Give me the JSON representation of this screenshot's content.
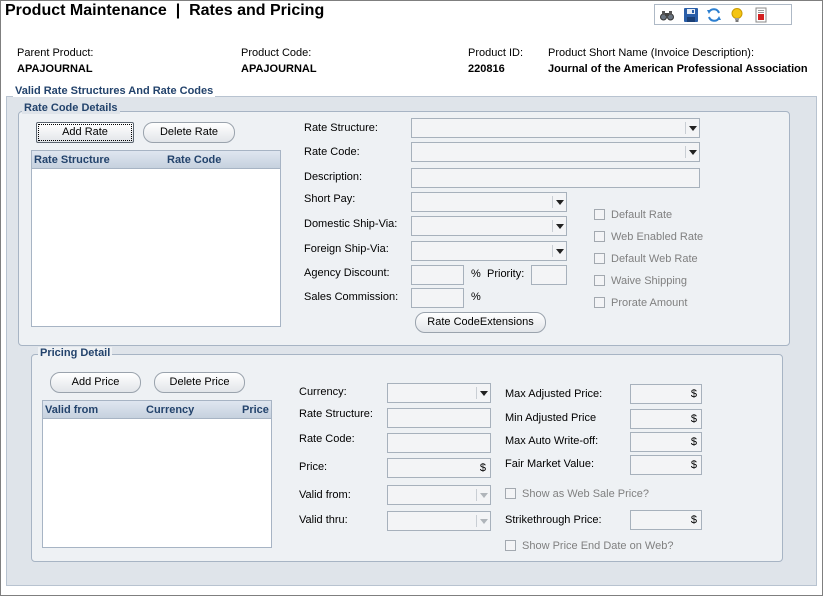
{
  "header": {
    "title": "Product Maintenance  |  Rates and Pricing",
    "toolbar": {
      "icons": [
        "binoculars-icon",
        "save-icon",
        "refresh-icon",
        "lightbulb-icon",
        "report-icon"
      ]
    }
  },
  "product": {
    "parent_label": "Parent Product:",
    "parent_value": "APAJOURNAL",
    "code_label": "Product Code:",
    "code_value": "APAJOURNAL",
    "id_label": "Product ID:",
    "id_value": "220816",
    "short_name_label": "Product Short Name (Invoice Description):",
    "short_name_value": "Journal of the American Professional Association"
  },
  "valid_rates": {
    "title": "Valid Rate Structures And Rate Codes",
    "rate_code_details": {
      "title": "Rate Code Details",
      "add_button": "Add Rate",
      "delete_button": "Delete Rate",
      "grid_columns": [
        "Rate Structure",
        "Rate Code"
      ],
      "labels": {
        "rate_structure": "Rate Structure:",
        "rate_code": "Rate Code:",
        "description": "Description:",
        "short_pay": "Short Pay:",
        "domestic_ship_via": "Domestic Ship-Via:",
        "foreign_ship_via": "Foreign Ship-Via:",
        "agency_discount": "Agency Discount:",
        "percent": "%",
        "priority": "Priority:",
        "sales_commission": "Sales Commission:"
      },
      "extensions_button": "Rate CodeExtensions",
      "checkboxes": [
        "Default Rate",
        "Web Enabled Rate",
        "Default Web Rate",
        "Waive Shipping",
        "Prorate Amount"
      ]
    }
  },
  "pricing": {
    "title": "Pricing Detail",
    "add_button": "Add Price",
    "delete_button": "Delete Price",
    "grid_columns": [
      "Valid from",
      "Currency",
      "Price"
    ],
    "labels": {
      "currency": "Currency:",
      "rate_structure": "Rate Structure:",
      "rate_code": "Rate Code:",
      "price": "Price:",
      "valid_from": "Valid from:",
      "valid_thru": "Valid thru:",
      "max_adjusted_price": "Max Adjusted Price:",
      "min_adjusted_price": "Min Adjusted Price",
      "max_auto_writeoff": "Max Auto Write-off:",
      "fair_market_value": "Fair Market Value:",
      "show_web_sale_price": "Show as Web Sale Price?",
      "strikethrough_price": "Strikethrough Price:",
      "show_price_end_date": "Show Price End Date on Web?"
    },
    "currency_symbol": "$"
  }
}
